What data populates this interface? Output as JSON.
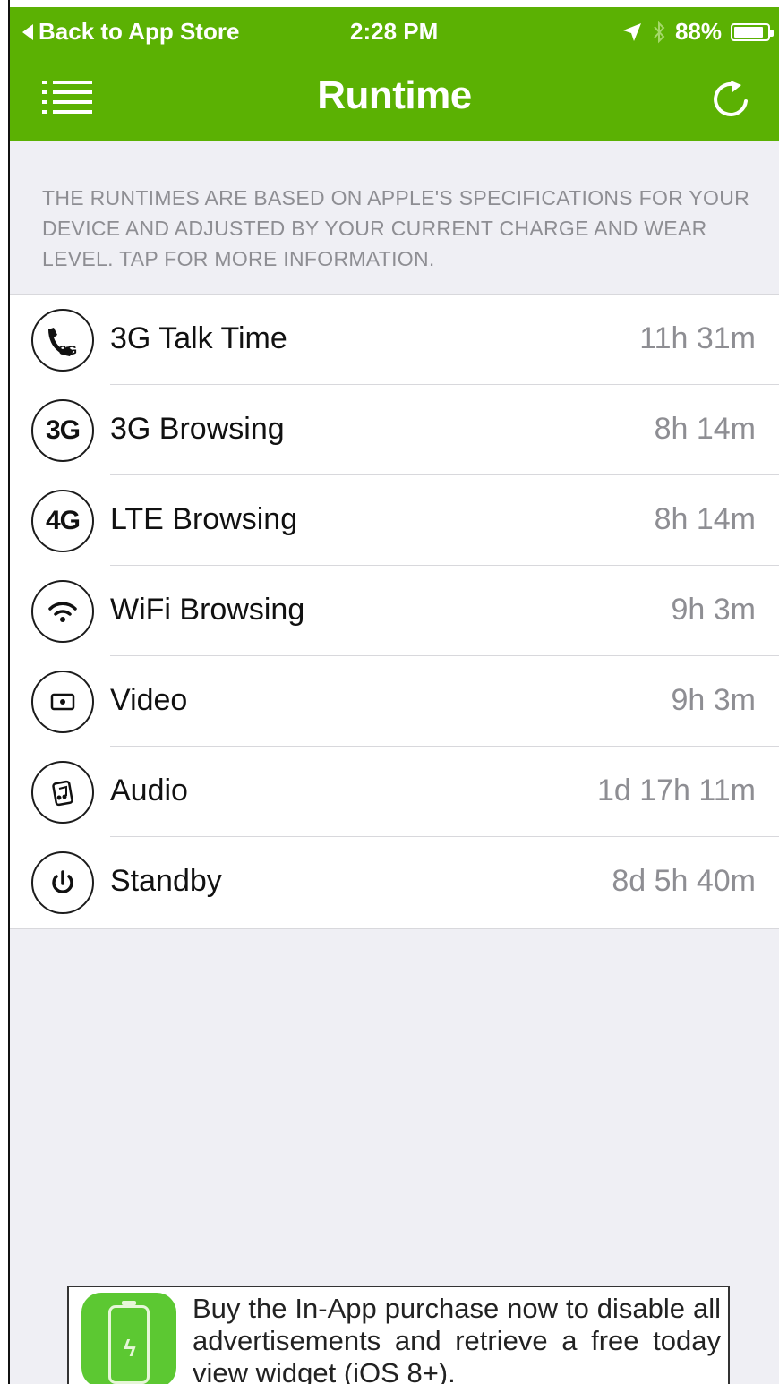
{
  "status_bar": {
    "back_label": "Back to App Store",
    "time": "2:28 PM",
    "battery": "88%",
    "battery_level": 0.88,
    "icons": [
      "location-arrow-icon",
      "bluetooth-icon",
      "battery-icon"
    ]
  },
  "navbar": {
    "title": "Runtime",
    "left_icon": "menu-list-icon",
    "right_icon": "refresh-icon"
  },
  "info_text": "THE RUNTIMES ARE BASED ON APPLE'S SPECIFICATIONS FOR YOUR DEVICE AND ADJUSTED BY YOUR CURRENT CHARGE AND WEAR LEVEL. TAP FOR MORE INFORMATION.",
  "runtimes": [
    {
      "label": "3G Talk Time",
      "value": "11h 31m",
      "icon": "phone-3g-icon",
      "icon_text": "3G"
    },
    {
      "label": "3G Browsing",
      "value": "8h 14m",
      "icon": "3g-icon",
      "icon_text": "3G"
    },
    {
      "label": "LTE Browsing",
      "value": "8h 14m",
      "icon": "4g-icon",
      "icon_text": "4G"
    },
    {
      "label": "WiFi Browsing",
      "value": "9h 3m",
      "icon": "wifi-icon"
    },
    {
      "label": "Video",
      "value": "9h 3m",
      "icon": "video-icon"
    },
    {
      "label": "Audio",
      "value": "1d 17h 11m",
      "icon": "audio-icon"
    },
    {
      "label": "Standby",
      "value": "8d 5h 40m",
      "icon": "power-icon"
    }
  ],
  "ad": {
    "text": "Buy the In-App purchase now to disable all advertisements and retrieve a free today view widget (iOS 8+).",
    "icon": "battery-app-icon"
  },
  "colors": {
    "header_green": "#5bb103",
    "background": "#efeff4",
    "secondary_text": "#8e8e93"
  }
}
